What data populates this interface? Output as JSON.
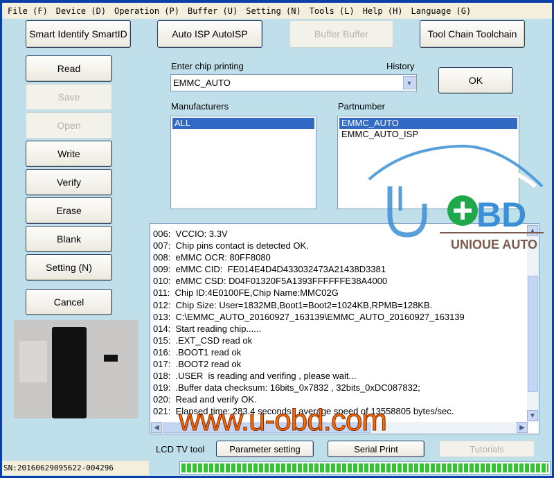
{
  "menu": [
    "File (F)",
    "Device (D)",
    "Operation (P)",
    "Buffer (U)",
    "Setting (N)",
    "Tools (L)",
    "Help (H)",
    "Language (G)"
  ],
  "top_buttons": {
    "smart": "Smart Identify SmartID",
    "autoisp": "Auto ISP AutoISP",
    "buffer": "Buffer Buffer",
    "toolchain": "Tool Chain Toolchain"
  },
  "left_buttons": {
    "read": "Read",
    "save": "Save",
    "open": "Open",
    "write": "Write",
    "verify": "Verify",
    "erase": "Erase",
    "blank": "Blank",
    "setting": "Setting (N)",
    "cancel": "Cancel"
  },
  "chip": {
    "label": "Enter chip printing",
    "history": "History",
    "value": "EMMC_AUTO",
    "ok": "OK"
  },
  "manufacturers": {
    "label": "Manufacturers",
    "items": [
      "ALL"
    ],
    "selected": "ALL"
  },
  "partnumber": {
    "label": "Partnumber",
    "items": [
      "EMMC_AUTO",
      "EMMC_AUTO_ISP"
    ],
    "selected": "EMMC_AUTO"
  },
  "log": [
    "006:  VCCIO: 3.3V",
    "007:  Chip pins contact is detected OK.",
    "008:  eMMC OCR: 80FF8080",
    "009:  eMMC CID:  FE014E4D4D433032473A21438D3381",
    "010:  eMMC CSD: D04F01320F5A1393FFFFFFE38A4000",
    "011:  Chip ID:4E0100FE,Chip Name:MMC02G",
    "012:  Chip Size: User=1832MB,Boot1=Boot2=1024KB,RPMB=128KB.",
    "013:  C:\\EMMC_AUTO_20160927_163139\\EMMC_AUTO_20160927_163139",
    "014:  Start reading chip......",
    "015:  .EXT_CSD read ok",
    "016:  .BOOT1 read ok",
    "017:  .BOOT2 read ok",
    "018:  .USER  is reading and verifing , please wait...",
    "019:  .Buffer data checksum: 16bits_0x7832 , 32bits_0xDC087832;",
    "020:  Read and verify OK.",
    "021:  Elapsed time: 283.4 seconds , average speed of 13558805 bytes/sec."
  ],
  "bottom": {
    "lcd_label": "LCD TV tool",
    "parameter": "Parameter setting",
    "serial": "Serial Print",
    "tutorials": "Tutorials"
  },
  "status": {
    "sn": "SN:20160629095622-004296",
    "progress_percent": 100
  },
  "watermark": {
    "logo": "OBD",
    "tagline": "UNIQUE AUTO",
    "url": "www.u-obd.com"
  },
  "colors": {
    "background": "#bfe0ea",
    "selection": "#316ac5",
    "progress": "#35c335",
    "watermark_orange": "#ff6a00",
    "logo_blue": "#3b8fd6"
  }
}
